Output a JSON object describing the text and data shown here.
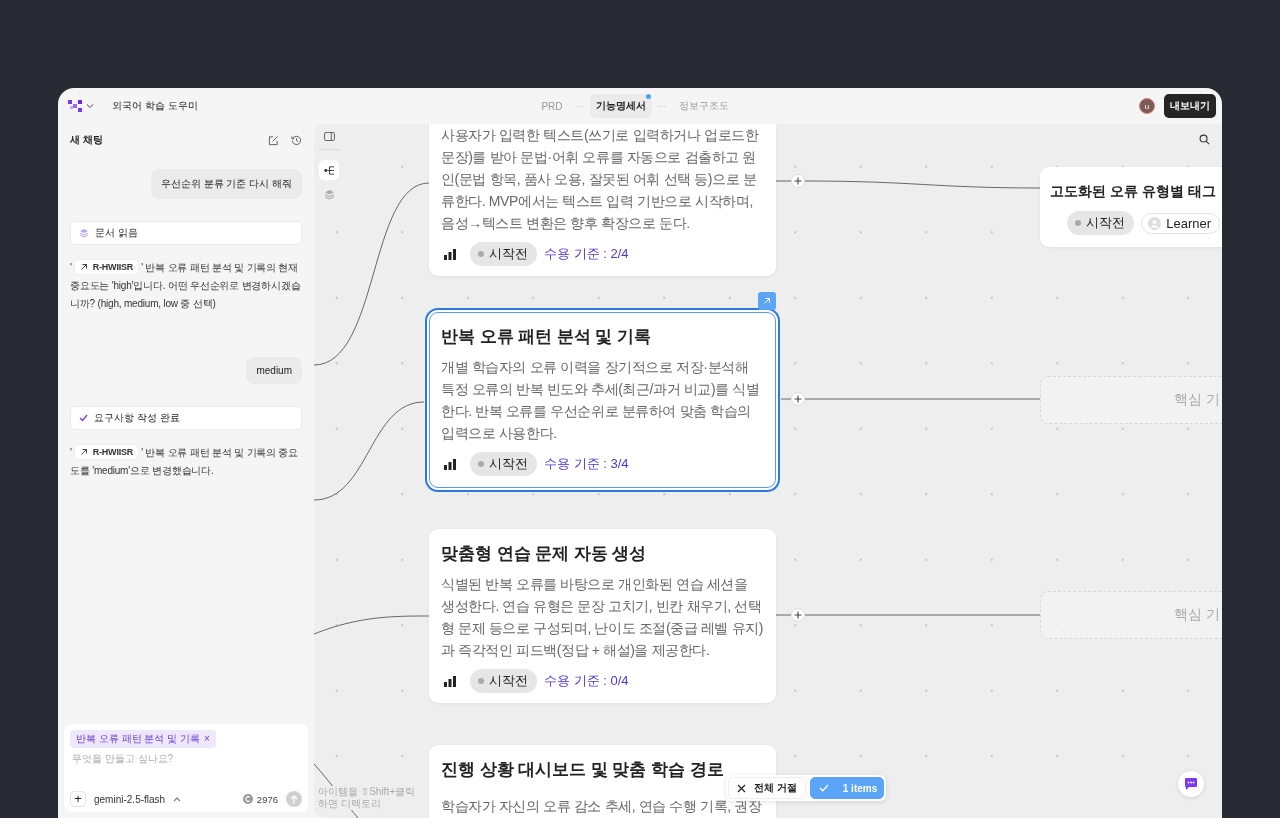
{
  "app": {
    "title": "외국어 학습 도우미"
  },
  "tabs": [
    {
      "label": "PRD",
      "selected": false,
      "badge": false
    },
    {
      "label": "기능명세서",
      "selected": true,
      "badge": true
    },
    {
      "label": "정보구조도",
      "selected": false,
      "badge": false
    }
  ],
  "tab_separators": [
    "···",
    "···"
  ],
  "user": {
    "avatar": "u"
  },
  "export_button": "내보내기",
  "chat": {
    "title": "새 채팅",
    "messages": [
      {
        "kind": "user",
        "text": "우선순위 분류 기준 다시 해줘"
      },
      {
        "kind": "tool",
        "done": false,
        "text": "문서 읽음"
      },
      {
        "kind": "assistant",
        "before": "'",
        "ref": "R-HWIISR",
        "after": "' 반복 오류 패턴 분석 및 기록의 현재 중요도는 'high'입니다. 어떤 우선순위로 변경하시겠습니까? (high, medium, low 중 선택)"
      },
      {
        "kind": "user",
        "text": "medium"
      },
      {
        "kind": "tool",
        "done": true,
        "text": "요구사항 작성 완료"
      },
      {
        "kind": "assistant",
        "before": "'",
        "ref": "R-HWIISR",
        "after": "' 반복 오류 패턴 분석 및 기록의 중요도를 'medium'으로 변경했습니다."
      }
    ],
    "composer": {
      "context_chip": "반복 오류 패턴 분석 및 기록",
      "chip_close": "×",
      "placeholder": "무엇을 만들고 싶나요?",
      "add_button": "+",
      "model": "gemini-2.5-flash",
      "credits": "2976"
    }
  },
  "canvas": {
    "view_modes": [
      {
        "kind": "tree",
        "selected": true
      },
      {
        "kind": "layers",
        "selected": false
      }
    ],
    "nodes": [
      {
        "description": "사용자가 입력한 텍스트(쓰기로 입력하거나 업로드한 문장)를 받아 문법·어휘 오류를 자동으로 검출하고 원인(문법 항목, 품사 오용, 잘못된 어휘 선택 등)으로 분류한다. MVP에서는 텍스트 입력 기반으로 시작하며, 음성→텍스트 변환은 향후 확장으로 둔다.",
        "status": "시작전",
        "acceptance": "수용 기준 : 2/4",
        "selected": false
      },
      {
        "title": "반복 오류 패턴 분석 및 기록",
        "description": "개별 학습자의 오류 이력을 장기적으로 저장·분석해 특정 오류의 반복 빈도와 추세(최근/과거 비교)를 식별한다. 반복 오류를 우선순위로 분류하여 맞춤 학습의 입력으로 사용한다.",
        "status": "시작전",
        "acceptance": "수용 기준 : 3/4",
        "selected": true
      },
      {
        "title": "맞춤형 연습 문제 자동 생성",
        "description": "식별된 반복 오류를 바탕으로 개인화된 연습 세션을 생성한다. 연습 유형은 문장 고치기, 빈칸 채우기, 선택형 문제 등으로 구성되며, 난이도 조절(중급 레벨 유지)과 즉각적인 피드백(정답 + 해설)을 제공한다.",
        "status": "시작전",
        "acceptance": "수용 기준 : 0/4",
        "selected": false
      },
      {
        "title": "진행 상황 대시보드 및 맞춤 학습 경로",
        "description": "학습자가 자신의 오류 감소 추세, 연습 수행 기록, 권장",
        "selected": false
      },
      {
        "title": "고도화된 오류 유형별 태그",
        "status": "시작전",
        "assignee": "Learner",
        "selected": false
      }
    ],
    "placeholders": [
      {
        "label": "핵심 기"
      },
      {
        "label": "핵심 기"
      }
    ],
    "hint": "아이템을 ⇧Shift+클릭하면 디렉토리",
    "bulk_actions": {
      "reject": "전체 거절",
      "accept": "1 items"
    }
  }
}
